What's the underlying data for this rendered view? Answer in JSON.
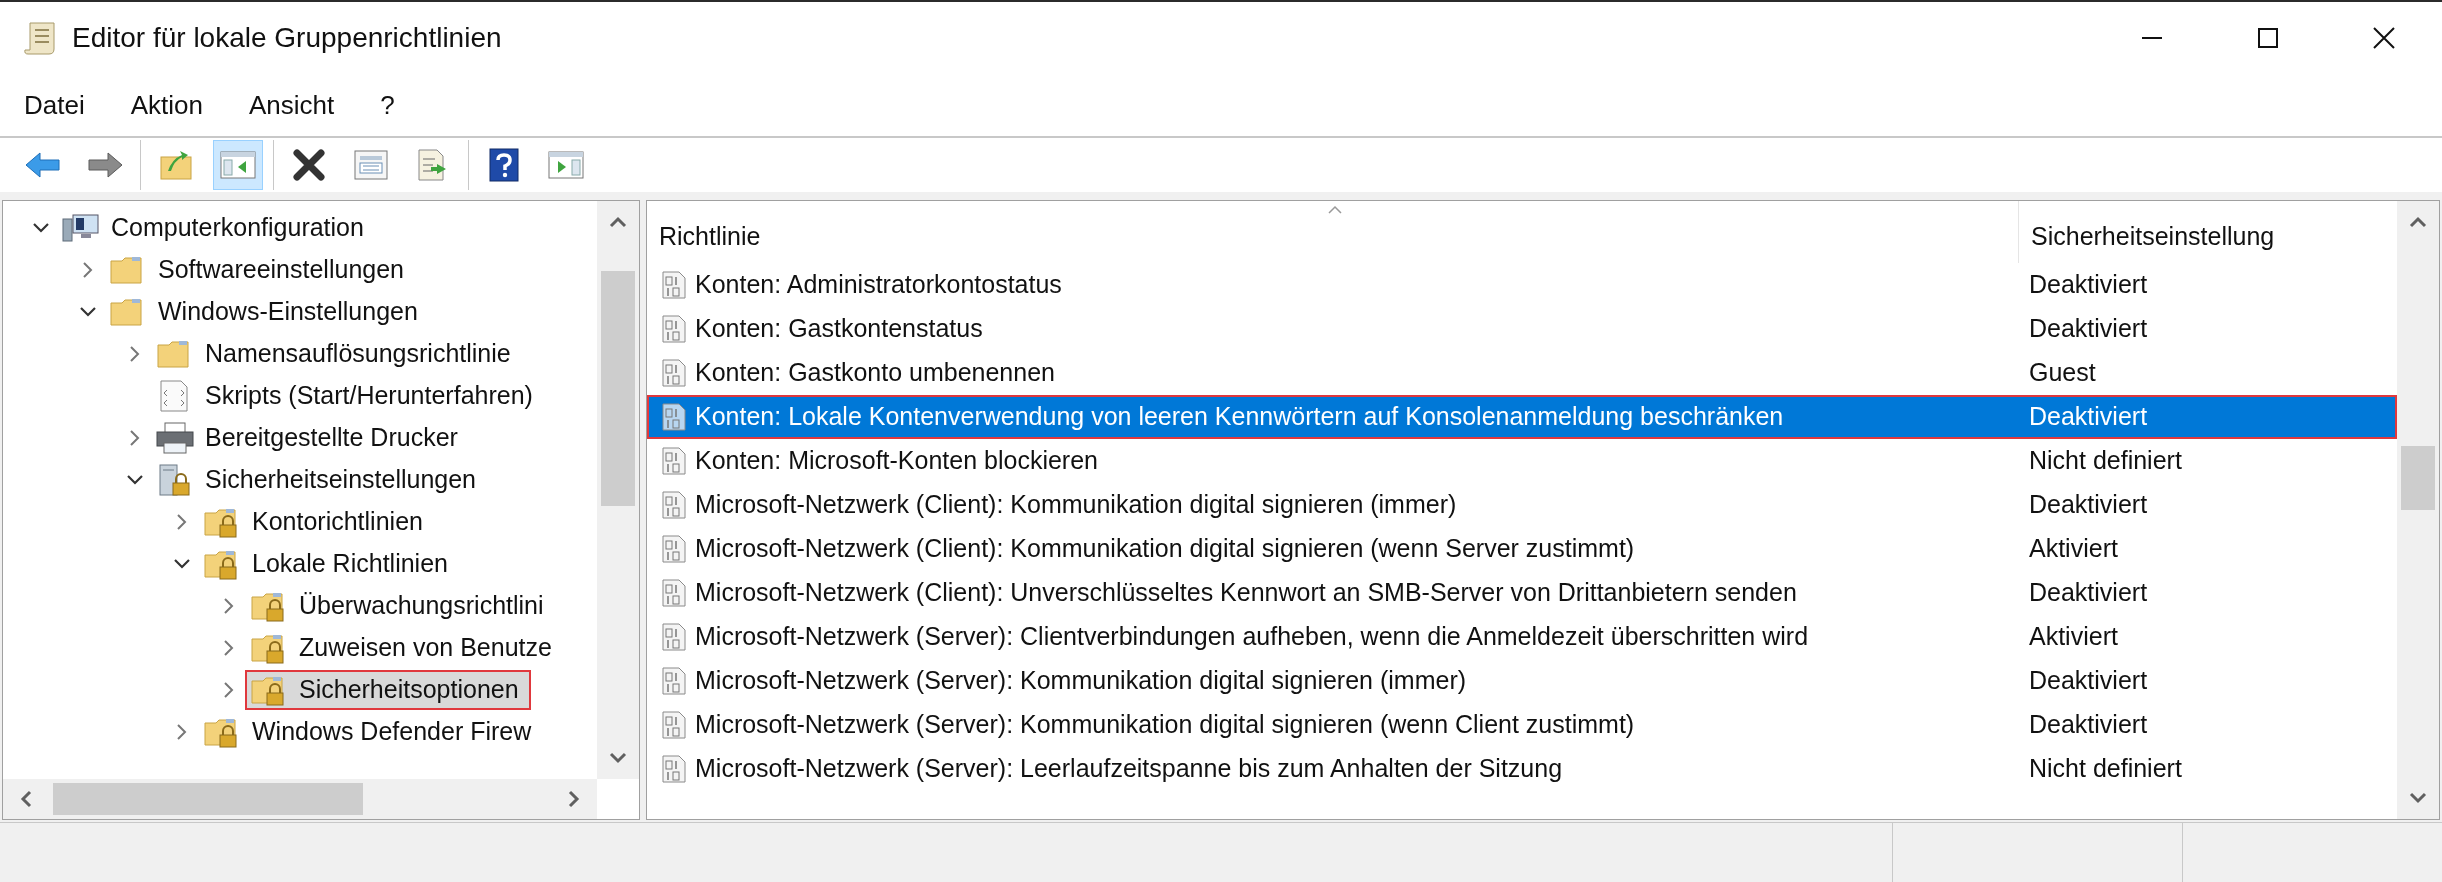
{
  "window": {
    "title": "Editor für lokale Gruppenrichtlinien"
  },
  "menu": [
    "Datei",
    "Aktion",
    "Ansicht",
    "?"
  ],
  "toolbar": [
    [
      {
        "kind": "back",
        "selected": false
      },
      {
        "kind": "forward",
        "selected": false
      }
    ],
    [
      {
        "kind": "up",
        "selected": false
      },
      {
        "kind": "tree",
        "selected": true
      }
    ],
    [
      {
        "kind": "delete",
        "selected": false
      },
      {
        "kind": "properties",
        "selected": false
      },
      {
        "kind": "export",
        "selected": false
      }
    ],
    [
      {
        "kind": "help",
        "selected": false
      },
      {
        "kind": "actionpane",
        "selected": false
      }
    ]
  ],
  "tree": [
    {
      "label": "Computerkonfiguration",
      "kind": "computer",
      "expanded": true,
      "selected": false,
      "children": [
        {
          "label": "Softwareeinstellungen",
          "kind": "folder",
          "expanded": false,
          "selected": false
        },
        {
          "label": "Windows-Einstellungen",
          "kind": "folder",
          "expanded": true,
          "selected": false,
          "children": [
            {
              "label": "Namensauflösungsrichtlinie",
              "kind": "folder",
              "expanded": false,
              "selected": false
            },
            {
              "label": "Skripts (Start/Herunterfahren)",
              "kind": "script",
              "selected": false
            },
            {
              "label": "Bereitgestellte Drucker",
              "kind": "printer",
              "expanded": false,
              "selected": false
            },
            {
              "label": "Sicherheitseinstellungen",
              "kind": "security",
              "expanded": true,
              "selected": false,
              "children": [
                {
                  "label": "Kontorichtlinien",
                  "kind": "lockfolder",
                  "expanded": false,
                  "selected": false
                },
                {
                  "label": "Lokale Richtlinien",
                  "kind": "lockfolder",
                  "expanded": true,
                  "selected": false,
                  "children": [
                    {
                      "label": "Überwachungsrichtlini",
                      "kind": "lockfolder",
                      "expanded": false,
                      "selected": false
                    },
                    {
                      "label": "Zuweisen von Benutze",
                      "kind": "lockfolder",
                      "expanded": false,
                      "selected": false
                    },
                    {
                      "label": "Sicherheitsoptionen",
                      "kind": "lockfolder",
                      "expanded": false,
                      "selected": true
                    }
                  ]
                },
                {
                  "label": "Windows Defender Firew",
                  "kind": "lockfolder",
                  "expanded": false,
                  "selected": false
                }
              ]
            }
          ]
        }
      ]
    }
  ],
  "table": {
    "columns": [
      "Richtlinie",
      "Sicherheitseinstellung"
    ],
    "rows": [
      {
        "policy": "Konten: Administratorkontostatus",
        "setting": "Deaktiviert",
        "selected": false
      },
      {
        "policy": "Konten: Gastkontenstatus",
        "setting": "Deaktiviert",
        "selected": false
      },
      {
        "policy": "Konten: Gastkonto umbenennen",
        "setting": "Guest",
        "selected": false
      },
      {
        "policy": "Konten: Lokale Kontenverwendung von leeren Kennwörtern auf Konsolenanmeldung beschränken",
        "setting": "Deaktiviert",
        "selected": true
      },
      {
        "policy": "Konten: Microsoft-Konten blockieren",
        "setting": "Nicht definiert",
        "selected": false
      },
      {
        "policy": "Microsoft-Netzwerk (Client): Kommunikation digital signieren (immer)",
        "setting": "Deaktiviert",
        "selected": false
      },
      {
        "policy": "Microsoft-Netzwerk (Client): Kommunikation digital signieren (wenn Server zustimmt)",
        "setting": "Aktiviert",
        "selected": false
      },
      {
        "policy": "Microsoft-Netzwerk (Client): Unverschlüsseltes Kennwort an SMB-Server von Drittanbietern senden",
        "setting": "Deaktiviert",
        "selected": false
      },
      {
        "policy": "Microsoft-Netzwerk (Server): Clientverbindungen aufheben, wenn die Anmeldezeit überschritten wird",
        "setting": "Aktiviert",
        "selected": false
      },
      {
        "policy": "Microsoft-Netzwerk (Server): Kommunikation digital signieren (immer)",
        "setting": "Deaktiviert",
        "selected": false
      },
      {
        "policy": "Microsoft-Netzwerk (Server): Kommunikation digital signieren (wenn Client zustimmt)",
        "setting": "Deaktiviert",
        "selected": false
      },
      {
        "policy": "Microsoft-Netzwerk (Server): Leerlaufzeitspanne bis zum Anhalten der Sitzung",
        "setting": "Nicht definiert",
        "selected": false
      }
    ]
  }
}
